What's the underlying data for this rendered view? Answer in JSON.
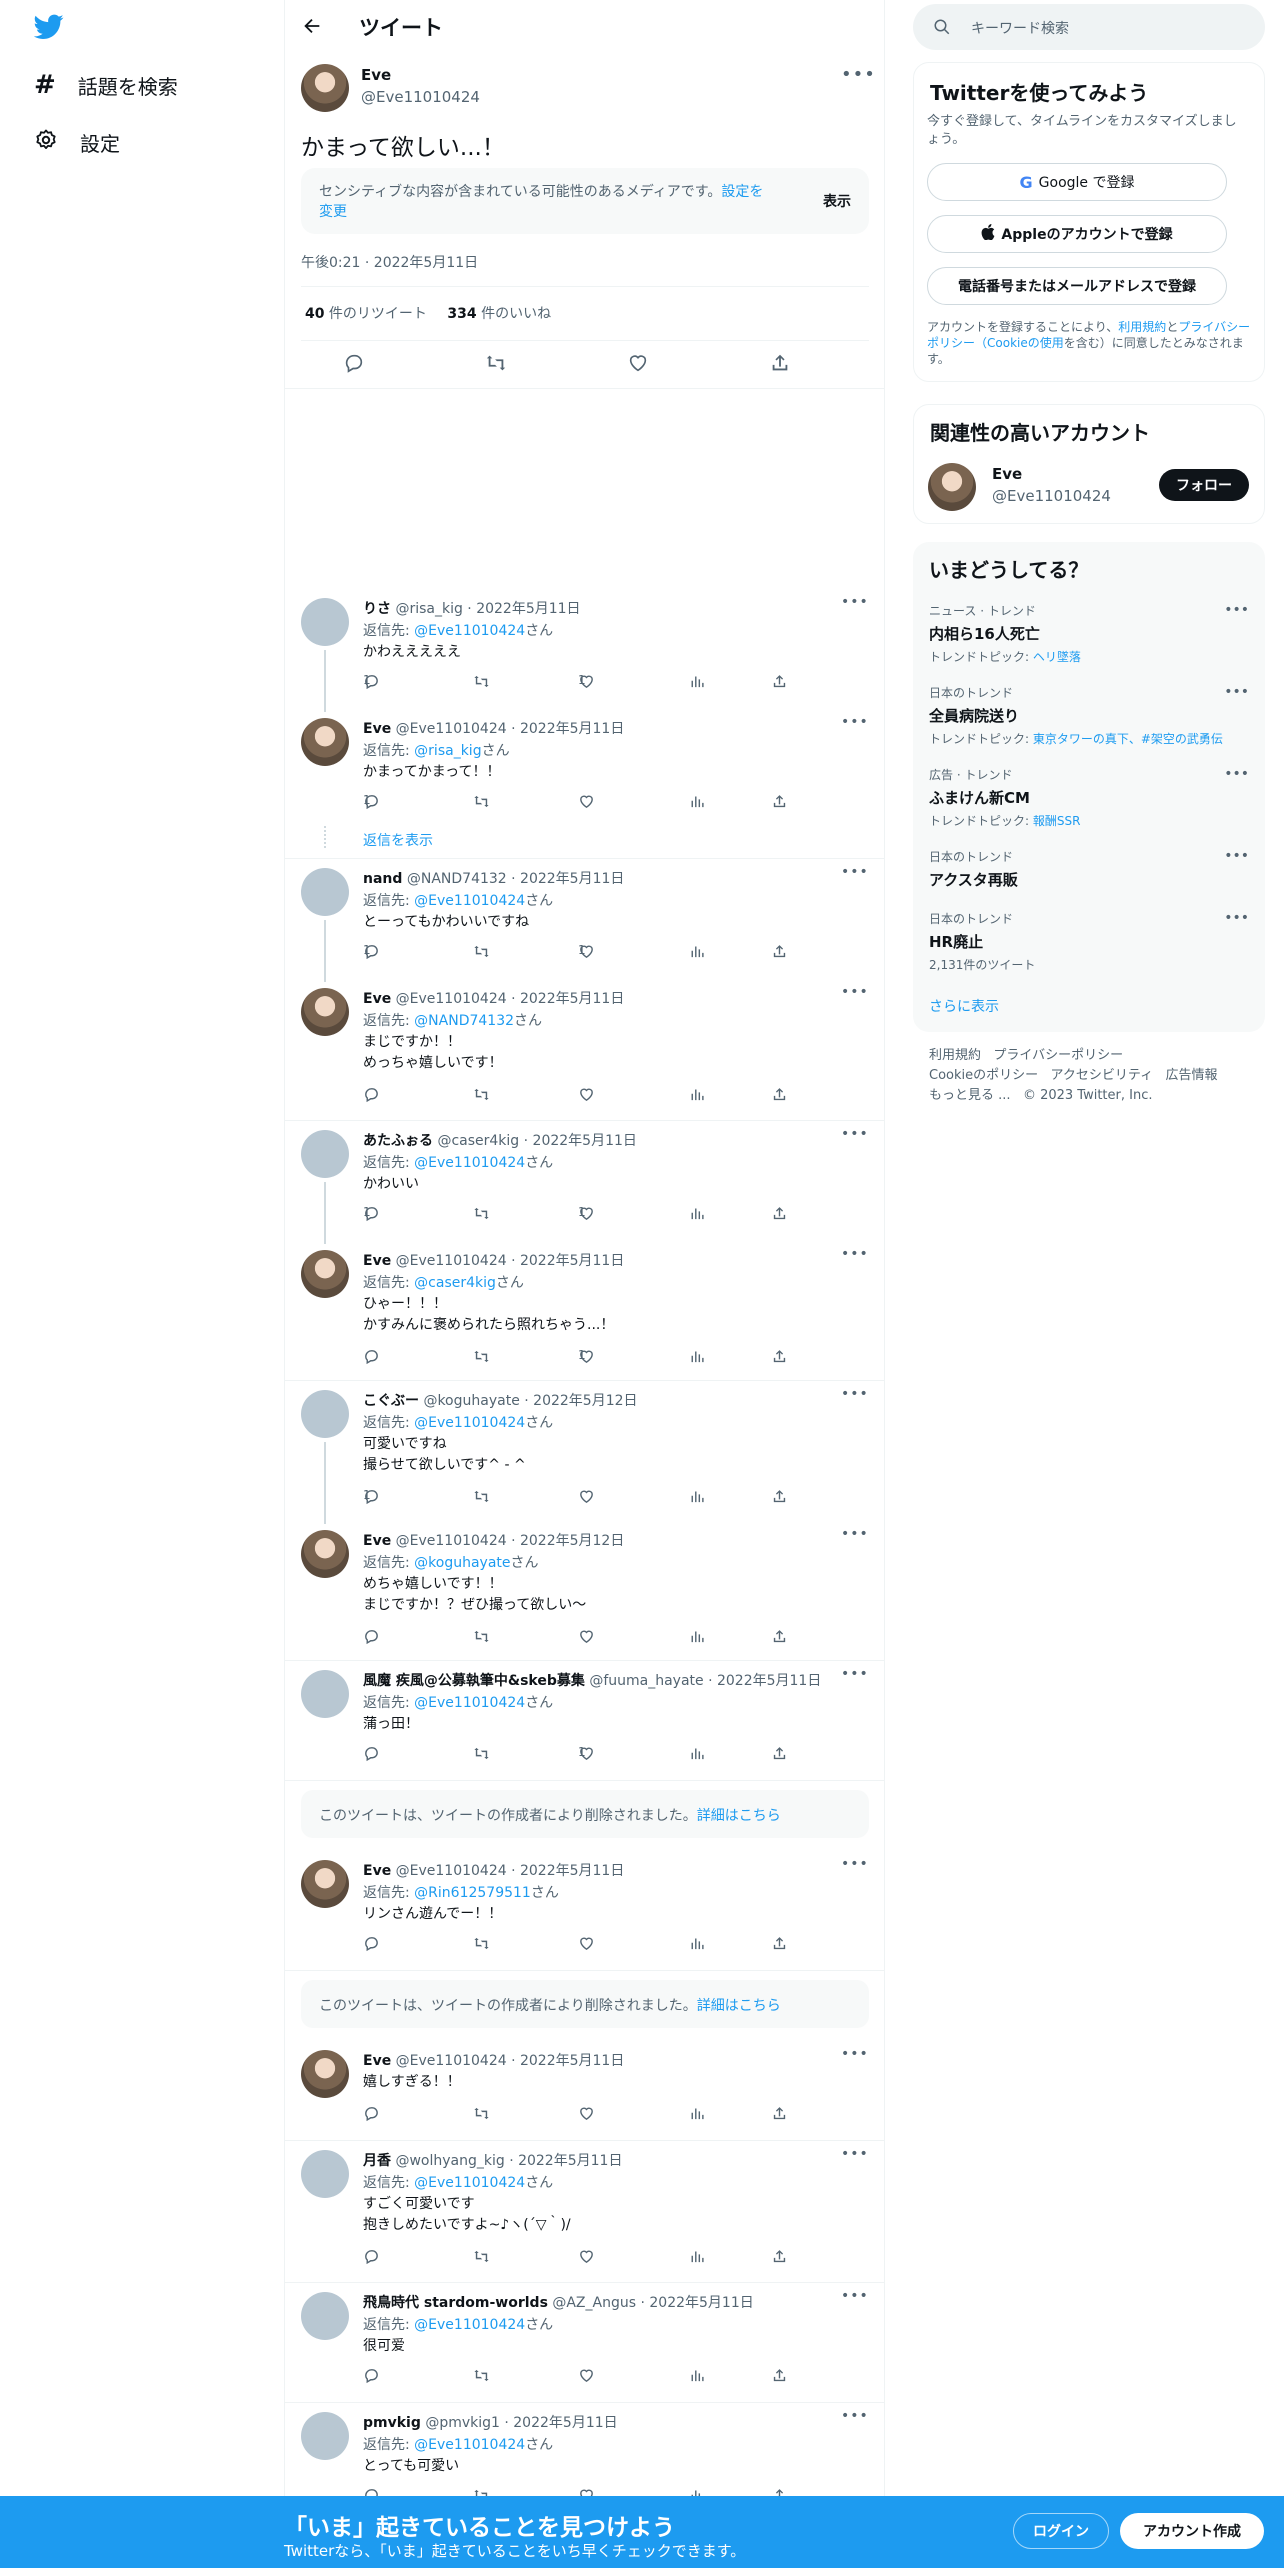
{
  "nav": {
    "items": [
      {
        "label": "話題を検索"
      },
      {
        "label": "設定"
      }
    ]
  },
  "header": {
    "title": "ツイート"
  },
  "tweet": {
    "name": "Eve",
    "handle": "@Eve11010424",
    "text": "かまって欲しい...！",
    "sensitive_text": "センシティブな内容が含まれている可能性のあるメディアです。",
    "sensitive_link": "設定を変更",
    "sensitive_show": "表示",
    "time": "午後0:21 · 2022年5月11日",
    "retweets": "40",
    "retweets_label": " 件のリツイート",
    "likes": "334",
    "likes_label": " 件のいいね"
  },
  "reply_prefix": "返信先: ",
  "reply_suffix": "さん",
  "show_replies": "返信を表示",
  "deleted_text": "このツイートは、ツイートの作成者により削除されました。",
  "deleted_link": "詳細はこちら",
  "replies": [
    {
      "name": "りさ",
      "meta": "@risa_kig · 2022年5月11日",
      "to": "@Eve11010424",
      "text": [
        "かわえええええ"
      ],
      "reply_count": "1",
      "like_count": "1",
      "avatar": "gray"
    },
    {
      "name": "Eve",
      "meta": "@Eve11010424 · 2022年5月11日",
      "to": "@risa_kig",
      "text": [
        "かまってかまって！！"
      ],
      "reply_count": "1",
      "like_count": "",
      "avatar": "eve"
    },
    {
      "name": "nand",
      "meta": "@NAND74132 · 2022年5月11日",
      "to": "@Eve11010424",
      "text": [
        "とーってもかわいいですね"
      ],
      "reply_count": "1",
      "like_count": "1",
      "avatar": "gray"
    },
    {
      "name": "Eve",
      "meta": "@Eve11010424 · 2022年5月11日",
      "to": "@NAND74132",
      "text": [
        "まじですか！！",
        "めっちゃ嬉しいです！"
      ],
      "reply_count": "",
      "like_count": "",
      "avatar": "eve"
    },
    {
      "name": "あたふぉる",
      "meta": "@caser4kig · 2022年5月11日",
      "to": "@Eve11010424",
      "text": [
        "かわいい"
      ],
      "reply_count": "1",
      "like_count": "1",
      "avatar": "gray"
    },
    {
      "name": "Eve",
      "meta": "@Eve11010424 · 2022年5月11日",
      "to": "@caser4kig",
      "text": [
        "ひゃー！！！",
        "かすみんに褒められたら照れちゃう...！"
      ],
      "reply_count": "",
      "like_count": "1",
      "avatar": "eve"
    },
    {
      "name": "こぐぶー",
      "meta": "@koguhayate · 2022年5月12日",
      "to": "@Eve11010424",
      "text": [
        "可愛いですね",
        "撮らせて欲しいです^ - ^"
      ],
      "reply_count": "1",
      "like_count": "",
      "avatar": "gray"
    },
    {
      "name": "Eve",
      "meta": "@Eve11010424 · 2022年5月12日",
      "to": "@koguhayate",
      "text": [
        "めちゃ嬉しいです！！",
        "まじですか！？ぜひ撮って欲しい〜"
      ],
      "reply_count": "",
      "like_count": "",
      "avatar": "eve"
    },
    {
      "name": "風魔 疾風@公募執筆中&skeb募集",
      "meta": "@fuuma_hayate · 2022年5月11日",
      "to": "@Eve11010424",
      "text": [
        "蒲っ田！"
      ],
      "reply_count": "",
      "like_count": "1",
      "avatar": "gray"
    },
    {
      "name": "Eve",
      "meta": "@Eve11010424 · 2022年5月11日",
      "to": "@Rin612579511",
      "text": [
        "リンさん遊んでー！！"
      ],
      "reply_count": "",
      "like_count": "",
      "avatar": "eve"
    },
    {
      "name": "Eve",
      "meta": "@Eve11010424 · 2022年5月11日",
      "to": "",
      "text": [
        "嬉しすぎる！！"
      ],
      "reply_count": "",
      "like_count": "",
      "avatar": "eve"
    },
    {
      "name": "月香",
      "meta": "@wolhyang_kig · 2022年5月11日",
      "to": "@Eve11010424",
      "text": [
        "すごく可愛いです",
        "抱きしめたいですよ~♪ヽ(´▽｀)/"
      ],
      "reply_count": "",
      "like_count": "",
      "avatar": "gray"
    },
    {
      "name": "飛鳥時代 stardom-worlds",
      "meta": "@AZ_Angus · 2022年5月11日",
      "to": "@Eve11010424",
      "text": [
        "很可爱"
      ],
      "reply_count": "",
      "like_count": "",
      "avatar": "gray"
    },
    {
      "name": "pmvkig",
      "meta": "@pmvkig1 · 2022年5月11日",
      "to": "@Eve11010424",
      "text": [
        "とっても可愛い"
      ],
      "reply_count": "",
      "like_count": "",
      "avatar": "gray"
    }
  ],
  "right": {
    "search_placeholder": "キーワード検索",
    "signup_title": "Twitterを使ってみよう",
    "signup_sub": "今すぐ登録して、タイムラインをカスタマイズしましょう。",
    "google_btn": "Google で登録",
    "apple_btn": "Appleのアカウントで登録",
    "phone_btn": "電話番号またはメールアドレスで登録",
    "terms_pre": "アカウントを登録することにより、",
    "terms_link1": "利用規約",
    "terms_and": "と",
    "terms_link2": "プライバシーポリシー（Cookieの使用",
    "terms_post": "を含む）に同意したとみなされます。",
    "related_title": "関連性の高いアカウント",
    "related_name": "Eve",
    "related_handle": "@Eve11010424",
    "follow_btn": "フォロー",
    "trends_title": "いまどうしてる？",
    "trends": [
      {
        "cat": "ニュース · トレンド",
        "name": "内相ら16人死亡",
        "topic_label": "トレンドトピック: ",
        "topic": "ヘリ墜落"
      },
      {
        "cat": "日本のトレンド",
        "name": "全員病院送り",
        "topic_label": "トレンドトピック: ",
        "topic": "東京タワーの真下、#架空の武勇伝"
      },
      {
        "cat": "広告 · トレンド",
        "name": "ふまけん新CM",
        "topic_label": "トレンドトピック: ",
        "topic": "報酬SSR"
      },
      {
        "cat": "日本のトレンド",
        "name": "アクスタ再販",
        "topic_label": "",
        "topic": ""
      },
      {
        "cat": "日本のトレンド",
        "name": "HR廃止",
        "topic_label": "2,131件のツイート",
        "topic": ""
      }
    ],
    "show_more": "さらに表示",
    "footer": [
      "利用規約",
      "プライバシーポリシー",
      "Cookieのポリシー",
      "アクセシビリティ",
      "広告情報",
      "もっと見る ...",
      "© 2023 Twitter, Inc."
    ]
  },
  "bottom": {
    "title": "「いま」起きていることを見つけよう",
    "subtitle": "Twitterなら、「いま」起きていることをいち早くチェックできます。",
    "login": "ログイン",
    "signup": "アカウント作成"
  },
  "colors": {
    "accent": "#1d9bf0",
    "text": "#0f1419",
    "muted": "#536471"
  }
}
